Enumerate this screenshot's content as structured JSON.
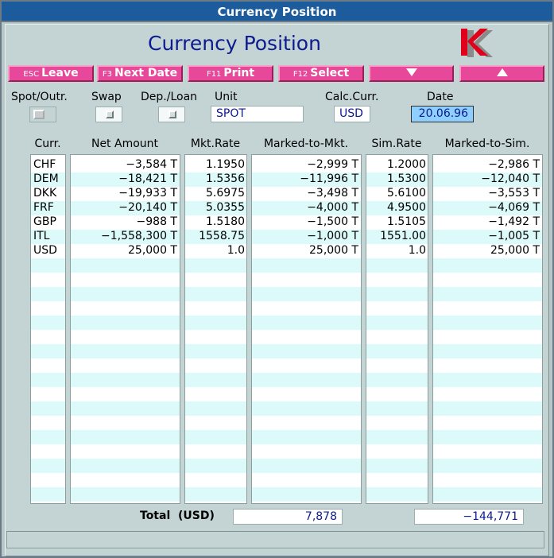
{
  "window": {
    "title": "Currency Position"
  },
  "header": {
    "heading": "Currency Position",
    "logo_icon": "k-logo-icon"
  },
  "toolbar": {
    "buttons": [
      {
        "key": "ESC",
        "label": "Leave"
      },
      {
        "key": "F3",
        "label": "Next Date"
      },
      {
        "key": "F11",
        "label": "Print"
      },
      {
        "key": "F12",
        "label": "Select"
      },
      {
        "key": "",
        "label": "",
        "icon": "arrow-down-icon"
      },
      {
        "key": "",
        "label": "",
        "icon": "arrow-up-icon"
      }
    ]
  },
  "filters": {
    "spot_outr_label": "Spot/Outr.",
    "swap_label": "Swap",
    "dep_loan_label": "Dep./Loan",
    "unit_label": "Unit",
    "unit_value": "SPOT",
    "calc_curr_label": "Calc.Curr.",
    "calc_curr_value": "USD",
    "date_label": "Date",
    "date_value": "20.06.96"
  },
  "table": {
    "columns": [
      "Curr.",
      "Net Amount",
      "Mkt.Rate",
      "Marked-to-Mkt.",
      "Sim.Rate",
      "Marked-to-Sim."
    ],
    "rows": [
      {
        "curr": "CHF",
        "net": "−3,584 T",
        "mkt_rate": "1.1950",
        "mtm": "−2,999 T",
        "sim_rate": "1.2000",
        "mts": "−2,986 T"
      },
      {
        "curr": "DEM",
        "net": "−18,421 T",
        "mkt_rate": "1.5356",
        "mtm": "−11,996 T",
        "sim_rate": "1.5300",
        "mts": "−12,040 T"
      },
      {
        "curr": "DKK",
        "net": "−19,933 T",
        "mkt_rate": "5.6975",
        "mtm": "−3,498 T",
        "sim_rate": "5.6100",
        "mts": "−3,553 T"
      },
      {
        "curr": "FRF",
        "net": "−20,140 T",
        "mkt_rate": "5.0355",
        "mtm": "−4,000 T",
        "sim_rate": "4.9500",
        "mts": "−4,069 T"
      },
      {
        "curr": "GBP",
        "net": "−988 T",
        "mkt_rate": "1.5180",
        "mtm": "−1,500 T",
        "sim_rate": "1.5105",
        "mts": "−1,492 T"
      },
      {
        "curr": "ITL",
        "net": "−1,558,300 T",
        "mkt_rate": "1558.75",
        "mtm": "−1,000 T",
        "sim_rate": "1551.00",
        "mts": "−1,005 T"
      },
      {
        "curr": "USD",
        "net": "25,000 T",
        "mkt_rate": "1.0",
        "mtm": "25,000 T",
        "sim_rate": "1.0",
        "mts": "25,000 T"
      }
    ]
  },
  "totals": {
    "label": "Total",
    "currency": "(USD)",
    "marked_to_mkt": "7,878",
    "marked_to_sim": "−144,771"
  },
  "colors": {
    "titlebar": "#1c5c9c",
    "heading": "#0d1b8e",
    "button": "#e8489a",
    "row_alt": "#dcfafa",
    "date_highlight": "#8ecfff",
    "logo_red": "#e0001a"
  }
}
